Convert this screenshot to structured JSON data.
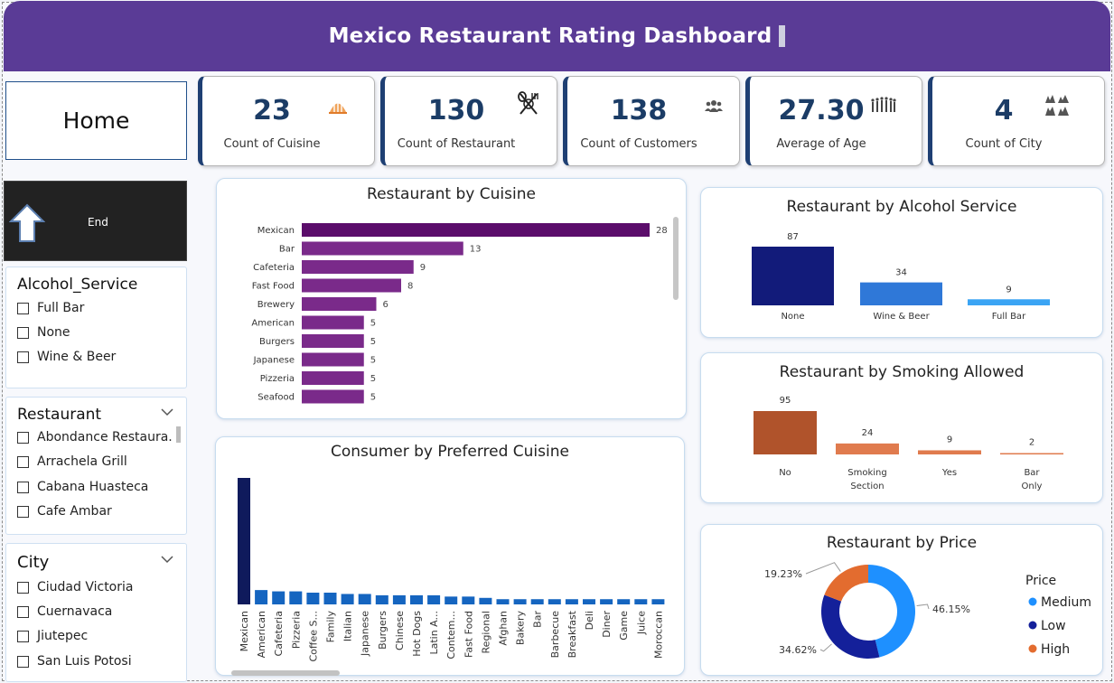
{
  "header": {
    "title": "Mexico Restaurant Rating Dashboard"
  },
  "nav": {
    "home_label": "Home",
    "end_label": "End"
  },
  "kpis": [
    {
      "value": "23",
      "label": "Count of Cuisine",
      "icon": "cuisine-icon"
    },
    {
      "value": "130",
      "label": "Count of Restaurant",
      "icon": "utensils-icon"
    },
    {
      "value": "138",
      "label": "Count of Customers",
      "icon": "people-icon"
    },
    {
      "value": "27.30",
      "label": "Average of Age",
      "icon": "age-icon"
    },
    {
      "value": "4",
      "label": "Count of City",
      "icon": "city-icon"
    }
  ],
  "slicers": {
    "alcohol": {
      "title": "Alcohol_Service",
      "options": [
        "Full Bar",
        "None",
        "Wine & Beer"
      ]
    },
    "restaurant": {
      "title": "Restaurant",
      "options": [
        "Abondance Restaura...",
        "Arrachela Grill",
        "Cabana Huasteca",
        "Cafe Ambar"
      ]
    },
    "city": {
      "title": "City",
      "options": [
        "Ciudad Victoria",
        "Cuernavaca",
        "Jiutepec",
        "San Luis Potosi"
      ]
    }
  },
  "chart_data": [
    {
      "id": "cuisine",
      "type": "bar",
      "orientation": "horizontal",
      "title": "Restaurant by Cuisine",
      "categories": [
        "Mexican",
        "Bar",
        "Cafeteria",
        "Fast Food",
        "Brewery",
        "American",
        "Burgers",
        "Japanese",
        "Pizzeria",
        "Seafood"
      ],
      "values": [
        28,
        13,
        9,
        8,
        6,
        5,
        5,
        5,
        5,
        5
      ],
      "colors": [
        "#5b0d6b",
        "#7a2a8a",
        "#7a2a8a",
        "#7a2a8a",
        "#7a2a8a",
        "#7a2a8a",
        "#7a2a8a",
        "#7a2a8a",
        "#7a2a8a",
        "#7a2a8a"
      ],
      "data_labels": true
    },
    {
      "id": "consumer",
      "type": "bar",
      "title": "Consumer by Preferred Cuisine",
      "categories": [
        "Mexican",
        "American",
        "Cafeteria",
        "Pizzeria",
        "Coffee S...",
        "Family",
        "Italian",
        "Japanese",
        "Burgers",
        "Chinese",
        "Hot Dogs",
        "Latin A...",
        "Contem...",
        "Fast Food",
        "Regional",
        "Afghan",
        "Bakery",
        "Bar",
        "Barbecue",
        "Breakfast",
        "Deli",
        "Diner",
        "Game",
        "Juice",
        "Moroccan"
      ],
      "values": [
        97,
        11,
        10,
        10,
        9,
        9,
        8,
        8,
        7,
        7,
        7,
        7,
        6,
        6,
        5,
        4,
        4,
        4,
        4,
        4,
        4,
        4,
        4,
        4,
        4
      ],
      "colors": [
        "#0f1a5c",
        "#1565c0"
      ]
    },
    {
      "id": "alcohol",
      "type": "bar",
      "title": "Restaurant by Alcohol Service",
      "categories": [
        "None",
        "Wine & Beer",
        "Full Bar"
      ],
      "values": [
        87,
        34,
        9
      ],
      "colors": [
        "#121b7a",
        "#2f78d8",
        "#3ba4f4"
      ]
    },
    {
      "id": "smoking",
      "type": "bar",
      "title": "Restaurant by Smoking Allowed",
      "categories": [
        "No",
        "Smoking Section",
        "Yes",
        "Bar Only"
      ],
      "values": [
        95,
        24,
        9,
        2
      ],
      "colors": [
        "#b0532b",
        "#e07b4e",
        "#e07b4e",
        "#e07b4e"
      ]
    },
    {
      "id": "price",
      "type": "pie",
      "title": "Restaurant by Price",
      "legend_title": "Price",
      "legend_position": "right",
      "categories": [
        "Medium",
        "Low",
        "High"
      ],
      "values": [
        46.15,
        34.62,
        19.23
      ],
      "labels": [
        "46.15%",
        "34.62%",
        "19.23%"
      ],
      "colors": [
        "#1e90ff",
        "#14209a",
        "#e36c2f"
      ]
    }
  ]
}
